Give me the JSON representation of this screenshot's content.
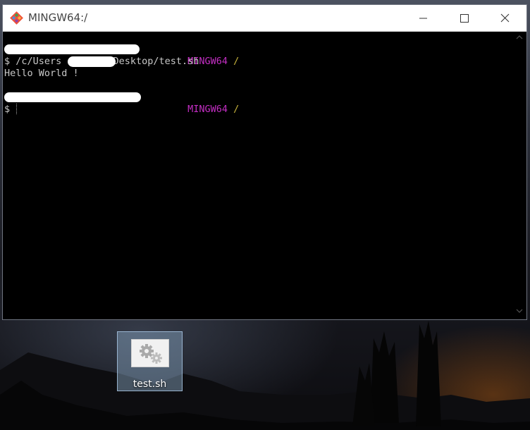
{
  "window": {
    "title": "MINGW64:/"
  },
  "terminal": {
    "lines": {
      "l1_env": "MINGW64",
      "l1_dir": "/",
      "l2_prompt": "$",
      "l2_cmd_a": "/c/Users",
      "l2_cmd_b": "Desktop/test.sh",
      "l3_output": "Hello World !",
      "l5_env": "MINGW64",
      "l5_dir": "/",
      "l6_prompt": "$"
    }
  },
  "desktop": {
    "file_label": "test.sh"
  },
  "colors": {
    "user_host": "#4ac24a",
    "env": "#c32ec3",
    "dir": "#c8b43c",
    "terminal_bg": "#000000"
  }
}
